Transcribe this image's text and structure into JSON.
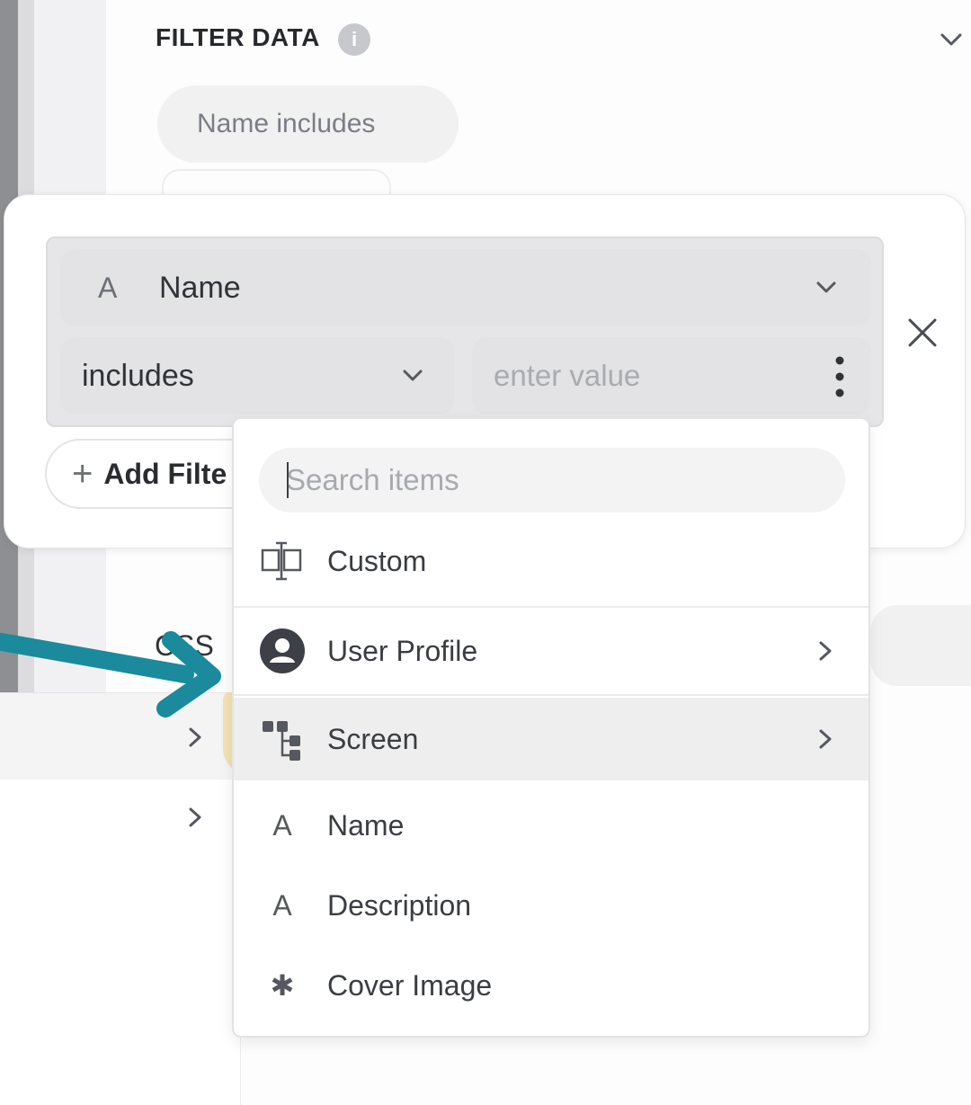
{
  "panel": {
    "section_title": "FILTER DATA",
    "info_icon": "i",
    "chip_label": "Name includes",
    "css_label": "CSS"
  },
  "filter": {
    "field_type_icon": "A",
    "field_label": "Name",
    "operator": "includes",
    "value_placeholder": "enter value",
    "add_filter_label": "Add Filte",
    "add_filter_icon": "+"
  },
  "menu": {
    "search_placeholder": "Search items",
    "items": [
      {
        "icon": "custom-field-icon",
        "label": "Custom",
        "has_submenu": false
      },
      {
        "icon": "user-profile-icon",
        "label": "User Profile",
        "has_submenu": true
      },
      {
        "icon": "screen-tree-icon",
        "label": "Screen",
        "has_submenu": true,
        "highlighted": true
      },
      {
        "icon": "text-type-icon",
        "glyph": "A",
        "label": "Name",
        "has_submenu": false
      },
      {
        "icon": "text-type-icon",
        "glyph": "A",
        "label": "Description",
        "has_submenu": false
      },
      {
        "icon": "asterisk-icon",
        "glyph": "✱",
        "label": "Cover Image",
        "has_submenu": false
      }
    ]
  },
  "colors": {
    "accent_arrow": "#1a8a9c",
    "highlight": "#f2d996"
  }
}
